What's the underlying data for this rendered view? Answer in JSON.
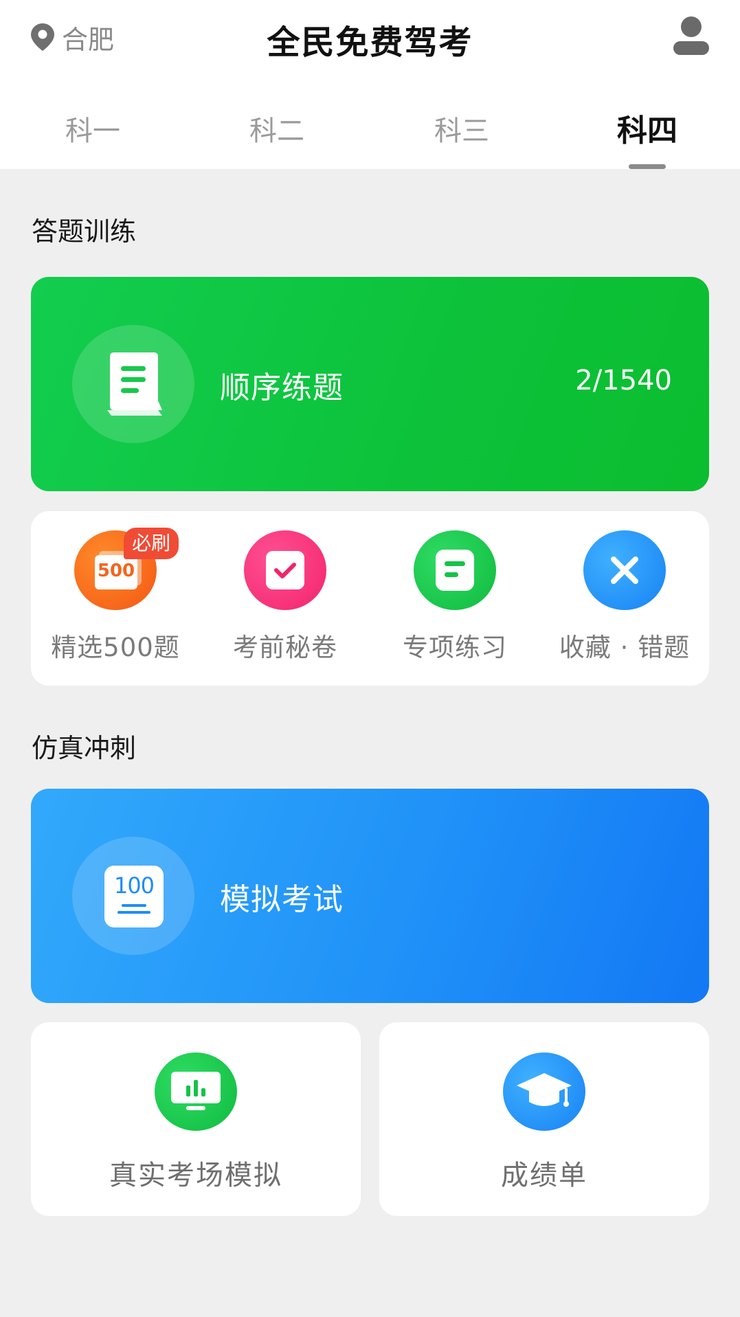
{
  "header": {
    "location": "合肥",
    "title": "全民免费驾考"
  },
  "tabs": [
    {
      "label": "科一",
      "active": false
    },
    {
      "label": "科二",
      "active": false
    },
    {
      "label": "科三",
      "active": false
    },
    {
      "label": "科四",
      "active": true
    }
  ],
  "practice": {
    "section_title": "答题训练",
    "banner": {
      "label": "顺序练题",
      "progress": "2/1540"
    },
    "quick_items": [
      {
        "label": "精选500题",
        "badge": "必刷",
        "icon_text": "500",
        "icon": "500-questions-icon",
        "color": "#f4641e"
      },
      {
        "label": "考前秘卷",
        "icon": "checkbox-icon",
        "color": "#f8327a"
      },
      {
        "label": "专项练习",
        "icon": "document-icon",
        "color": "#14c349"
      },
      {
        "label": "收藏 · 错题",
        "icon": "close-icon",
        "color": "#1f8cf6"
      }
    ]
  },
  "sprint": {
    "section_title": "仿真冲刺",
    "banner": {
      "label": "模拟考试",
      "icon_text": "100"
    },
    "cards": [
      {
        "label": "真实考场模拟",
        "icon": "monitor-chart-icon",
        "color": "#14c34a"
      },
      {
        "label": "成绩单",
        "icon": "graduation-cap-icon",
        "color": "#1c8df6"
      }
    ]
  },
  "colors": {
    "green_banner": "#10c63f",
    "blue_banner": "#2091f8",
    "background": "#efefef"
  }
}
